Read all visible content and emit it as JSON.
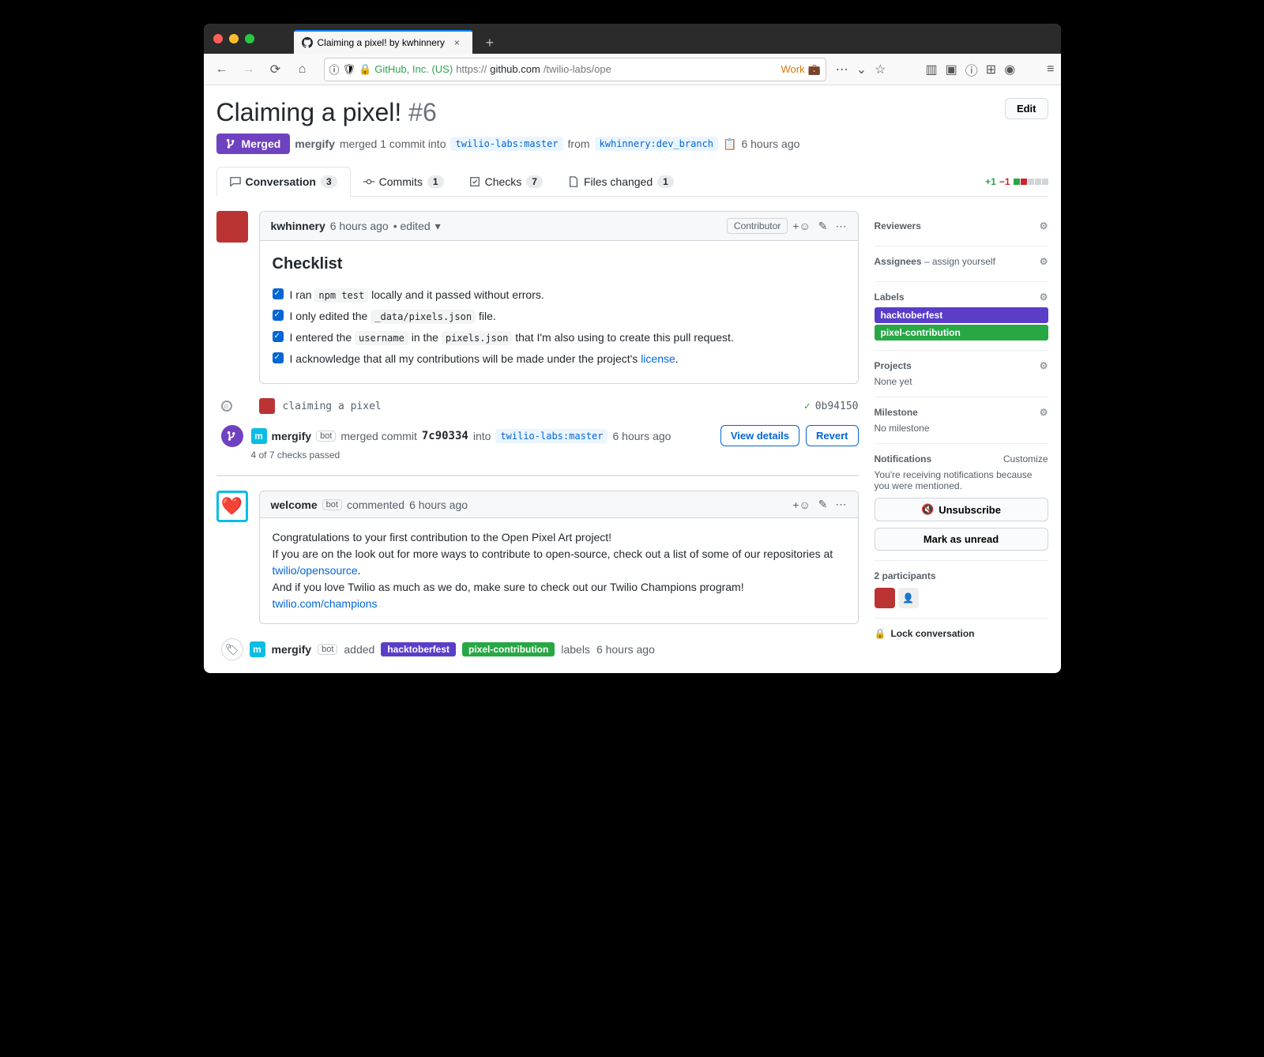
{
  "browser": {
    "tab_title": "Claiming a pixel! by kwhinnery",
    "ev_cert": "GitHub, Inc. (US)",
    "url_prefix": "https://",
    "url_host": "github.com",
    "url_path": "/twilio-labs/ope",
    "work_tag": "Work"
  },
  "pr": {
    "title": "Claiming a pixel!",
    "number": "#6",
    "edit_btn": "Edit",
    "state": "Merged",
    "merged_by": "mergify",
    "merged_text1": "merged 1 commit into",
    "base_branch": "twilio-labs:master",
    "merged_text2": "from",
    "head_branch": "kwhinnery:dev_branch",
    "merged_time": "6 hours ago"
  },
  "tabs": {
    "conversation": "Conversation",
    "conversation_count": "3",
    "commits": "Commits",
    "commits_count": "1",
    "checks": "Checks",
    "checks_count": "7",
    "files": "Files changed",
    "files_count": "1",
    "diff_add": "+1",
    "diff_del": "−1"
  },
  "c1": {
    "author": "kwhinnery",
    "time": "6 hours ago",
    "edited": "• edited",
    "badge": "Contributor",
    "heading": "Checklist",
    "i1a": "I ran ",
    "i1b": "npm test",
    "i1c": " locally and it passed without errors.",
    "i2a": "I only edited the ",
    "i2b": "_data/pixels.json",
    "i2c": " file.",
    "i3a": "I entered the ",
    "i3b": "username",
    "i3c": " in the ",
    "i3d": "pixels.json",
    "i3e": " that I'm also using to create this pull request.",
    "i4a": "I acknowledge that all my contributions will be made under the project's ",
    "i4b": "license",
    "i4c": "."
  },
  "commit": {
    "msg": "claiming a pixel",
    "sha": "0b94150"
  },
  "merge": {
    "actor": "mergify",
    "bot": "bot",
    "text1": "merged commit",
    "sha": "7c90334",
    "text2": "into",
    "target": "twilio-labs:master",
    "time": "6 hours ago",
    "view": "View details",
    "revert": "Revert",
    "checks": "4 of 7 checks passed"
  },
  "c2": {
    "author": "welcome",
    "bot": "bot",
    "action": "commented",
    "time": "6 hours ago",
    "p1": "Congratulations to your first contribution to the Open Pixel Art project!",
    "p2a": "If you are on the look out for more ways to contribute to open-source, check out a list of some of our repositories at ",
    "p2b": "twilio/opensource",
    "p2c": ".",
    "p3a": "And if you love Twilio as much as we do, make sure to check out our Twilio Champions program! ",
    "p3b": "twilio.com/champions"
  },
  "labelev": {
    "actor": "mergify",
    "bot": "bot",
    "added": "added",
    "l1": "hacktoberfest",
    "l2": "pixel-contribution",
    "text": "labels",
    "time": "6 hours ago"
  },
  "side": {
    "reviewers": "Reviewers",
    "assignees": "Assignees",
    "assign_self": "– assign yourself",
    "labels": "Labels",
    "l1": "hacktoberfest",
    "l2": "pixel-contribution",
    "projects": "Projects",
    "none_yet": "None yet",
    "milestone": "Milestone",
    "no_milestone": "No milestone",
    "notifications": "Notifications",
    "customize": "Customize",
    "notif_reason": "You're receiving notifications because you were mentioned.",
    "unsubscribe": "Unsubscribe",
    "mark_unread": "Mark as unread",
    "participants": "2 participants",
    "lock": "Lock conversation"
  }
}
